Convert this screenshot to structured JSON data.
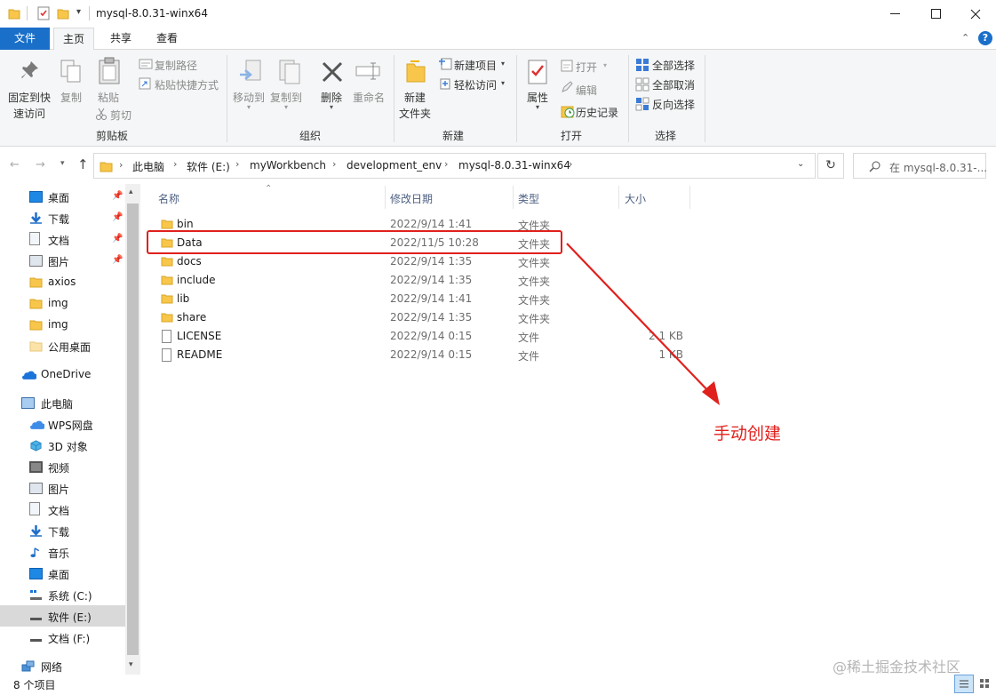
{
  "window": {
    "title": "mysql-8.0.31-winx64",
    "controls": [
      "minimize",
      "maximize",
      "close"
    ]
  },
  "ribbon_tabs": {
    "file": "文件",
    "home": "主页",
    "share": "共享",
    "view": "查看"
  },
  "ribbon": {
    "clipboard": {
      "pin_line1": "固定到快",
      "pin_line2": "速访问",
      "copy": "复制",
      "paste": "粘贴",
      "copy_path": "复制路径",
      "paste_shortcut": "粘贴快捷方式",
      "cut": "剪切",
      "group": "剪贴板"
    },
    "organize": {
      "move_to": "移动到",
      "copy_to": "复制到",
      "delete": "删除",
      "rename": "重命名",
      "group": "组织"
    },
    "new": {
      "new_folder_line1": "新建",
      "new_folder_line2": "文件夹",
      "new_item": "新建项目",
      "easy_access": "轻松访问",
      "group": "新建"
    },
    "open": {
      "properties": "属性",
      "open": "打开",
      "edit": "编辑",
      "history": "历史记录",
      "group": "打开"
    },
    "select": {
      "select_all": "全部选择",
      "select_none": "全部取消",
      "invert": "反向选择",
      "group": "选择"
    }
  },
  "address": {
    "crumbs": [
      "此电脑",
      "软件 (E:)",
      "myWorkbench",
      "development_env",
      "mysql-8.0.31-winx64"
    ],
    "search_placeholder": "在 mysql-8.0.31-..."
  },
  "nav": {
    "quick": [
      {
        "label": "桌面",
        "pinned": true
      },
      {
        "label": "下载",
        "pinned": true
      },
      {
        "label": "文档",
        "pinned": true
      },
      {
        "label": "图片",
        "pinned": true
      },
      {
        "label": "axios"
      },
      {
        "label": "img"
      },
      {
        "label": "img"
      },
      {
        "label": "公用桌面"
      }
    ],
    "onedrive": "OneDrive",
    "thispc": "此电脑",
    "pc_items": [
      "WPS网盘",
      "3D 对象",
      "视频",
      "图片",
      "文档",
      "下载",
      "音乐",
      "桌面",
      "系统 (C:)",
      "软件 (E:)",
      "文档 (F:)"
    ],
    "network": "网络",
    "selected_item": "软件 (E:)"
  },
  "columns": {
    "name": "名称",
    "date": "修改日期",
    "type": "类型",
    "size": "大小"
  },
  "files": [
    {
      "name": "bin",
      "date": "2022/9/14 1:41",
      "type": "文件夹",
      "size": "",
      "kind": "folder"
    },
    {
      "name": "Data",
      "date": "2022/11/5 10:28",
      "type": "文件夹",
      "size": "",
      "kind": "folder"
    },
    {
      "name": "docs",
      "date": "2022/9/14 1:35",
      "type": "文件夹",
      "size": "",
      "kind": "folder"
    },
    {
      "name": "include",
      "date": "2022/9/14 1:35",
      "type": "文件夹",
      "size": "",
      "kind": "folder"
    },
    {
      "name": "lib",
      "date": "2022/9/14 1:41",
      "type": "文件夹",
      "size": "",
      "kind": "folder"
    },
    {
      "name": "share",
      "date": "2022/9/14 1:35",
      "type": "文件夹",
      "size": "",
      "kind": "folder"
    },
    {
      "name": "LICENSE",
      "date": "2022/9/14 0:15",
      "type": "文件",
      "size": "2 1 KB",
      "kind": "file"
    },
    {
      "name": "README",
      "date": "2022/9/14 0:15",
      "type": "文件",
      "size": "1 KB",
      "kind": "file"
    }
  ],
  "annotation": "手动创建",
  "status": {
    "count": "8 个项目"
  },
  "watermark": "@稀土掘金技术社区",
  "colors": {
    "accent": "#1a6fc9",
    "annotation_red": "#e0201d",
    "folder_yellow": "#f7c64a"
  }
}
